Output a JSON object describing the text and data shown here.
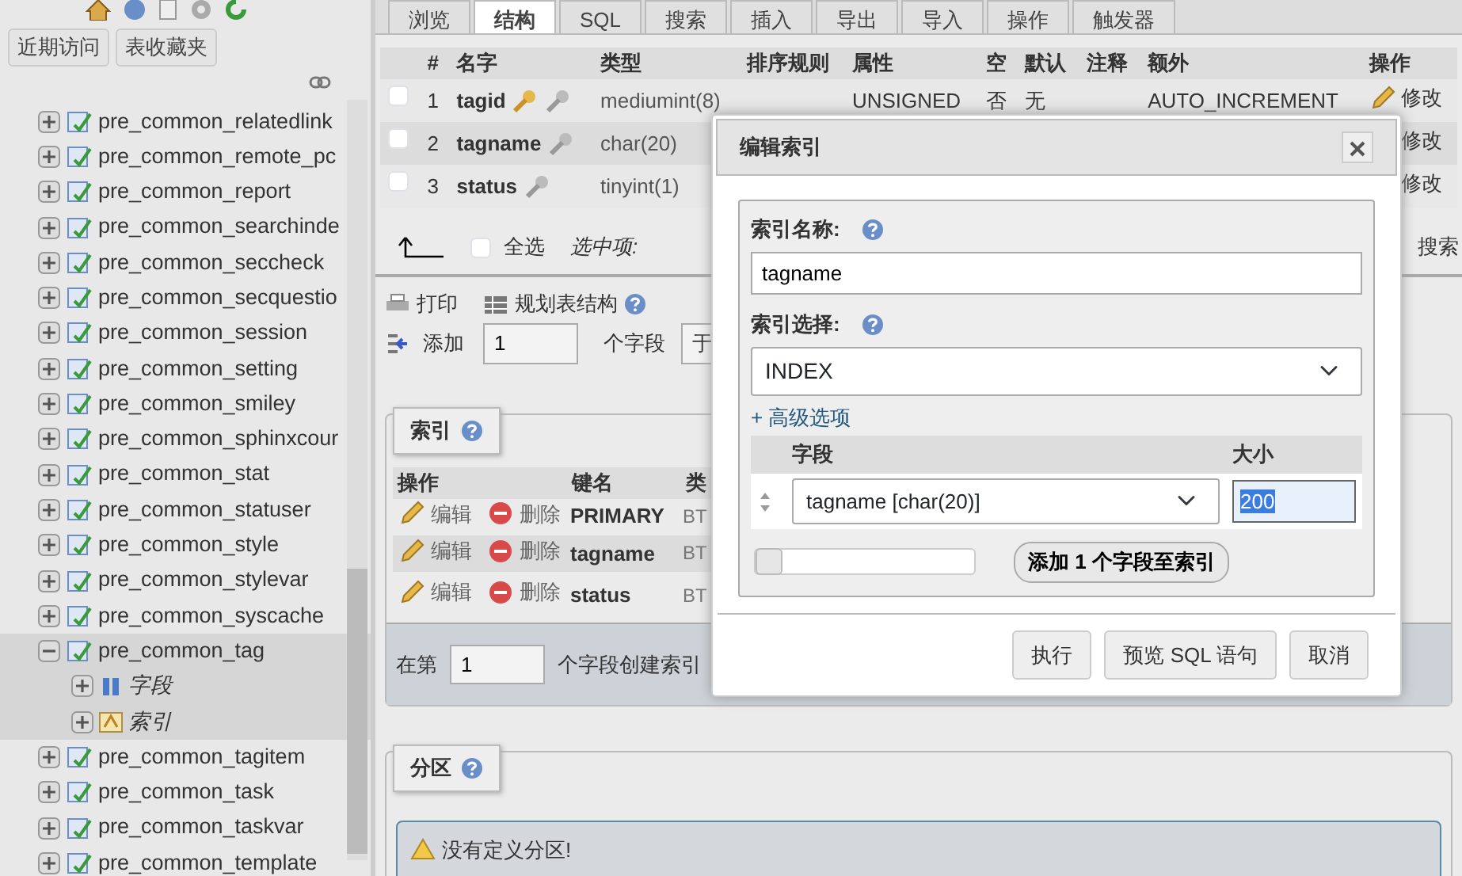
{
  "sidebar": {
    "buttons": [
      "近期访问",
      "表收藏夹"
    ],
    "tree": [
      {
        "label": "pre_common_relatedlink",
        "expanded": false
      },
      {
        "label": "pre_common_remote_pc",
        "expanded": false
      },
      {
        "label": "pre_common_report",
        "expanded": false
      },
      {
        "label": "pre_common_searchinde",
        "expanded": false
      },
      {
        "label": "pre_common_seccheck",
        "expanded": false
      },
      {
        "label": "pre_common_secquestio",
        "expanded": false
      },
      {
        "label": "pre_common_session",
        "expanded": false
      },
      {
        "label": "pre_common_setting",
        "expanded": false
      },
      {
        "label": "pre_common_smiley",
        "expanded": false
      },
      {
        "label": "pre_common_sphinxcour",
        "expanded": false
      },
      {
        "label": "pre_common_stat",
        "expanded": false
      },
      {
        "label": "pre_common_statuser",
        "expanded": false
      },
      {
        "label": "pre_common_style",
        "expanded": false
      },
      {
        "label": "pre_common_stylevar",
        "expanded": false
      },
      {
        "label": "pre_common_syscache",
        "expanded": false
      },
      {
        "label": "pre_common_tag",
        "expanded": true,
        "children": [
          {
            "label": "字段",
            "kind": "columns"
          },
          {
            "label": "索引",
            "kind": "indexes"
          }
        ]
      },
      {
        "label": "pre_common_tagitem",
        "expanded": false
      },
      {
        "label": "pre_common_task",
        "expanded": false
      },
      {
        "label": "pre_common_taskvar",
        "expanded": false
      },
      {
        "label": "pre_common_template",
        "expanded": false
      }
    ]
  },
  "tabs": [
    {
      "label": "浏览",
      "selected": false
    },
    {
      "label": "结构",
      "selected": true
    },
    {
      "label": "SQL",
      "selected": false
    },
    {
      "label": "搜索",
      "selected": false
    },
    {
      "label": "插入",
      "selected": false
    },
    {
      "label": "导出",
      "selected": false
    },
    {
      "label": "导入",
      "selected": false
    },
    {
      "label": "操作",
      "selected": false
    },
    {
      "label": "触发器",
      "selected": false
    }
  ],
  "structure": {
    "columns": [
      "#",
      "名字",
      "类型",
      "排序规则",
      "属性",
      "空",
      "默认",
      "注释",
      "额外",
      "操作"
    ],
    "rows": [
      {
        "checked": false,
        "highlighted": false,
        "number": "1",
        "name": "tagid",
        "primary": true,
        "type": "mediumint(8)",
        "attributes": "UNSIGNED",
        "null": "否",
        "default": "无",
        "extra": "AUTO_INCREMENT",
        "action": "修改"
      },
      {
        "checked": false,
        "highlighted": true,
        "number": "2",
        "name": "tagname",
        "primary": false,
        "type": "char(20)",
        "action": "修改"
      },
      {
        "checked": false,
        "highlighted": false,
        "number": "3",
        "name": "status",
        "primary": false,
        "type": "tinyint(1)",
        "action": "修改"
      }
    ],
    "check_all": {
      "label": "全选",
      "checked": false
    },
    "with_selected": "选中项:",
    "search_link": "搜索"
  },
  "actions": {
    "print": "打印",
    "plan": "规划表结构",
    "add_label": "添加",
    "add_count": "1",
    "add_unit": "个字段",
    "add_position": "于"
  },
  "indexes": {
    "legend": "索引",
    "columns": [
      "操作",
      "键名",
      "类"
    ],
    "rows": [
      {
        "edit": "编辑",
        "drop": "删除",
        "key_name": "PRIMARY",
        "type": "BT",
        "highlighted": false
      },
      {
        "edit": "编辑",
        "drop": "删除",
        "key_name": "tagname",
        "type": "BT",
        "highlighted": true
      },
      {
        "edit": "编辑",
        "drop": "删除",
        "key_name": "status",
        "type": "BT",
        "highlighted": false
      }
    ],
    "create_prefix": "在第",
    "create_count": "1",
    "create_suffix": "个字段创建索引"
  },
  "partitions": {
    "legend": "分区",
    "message": "没有定义分区!"
  },
  "dialog": {
    "title": "编辑索引",
    "name_label": "索引名称:",
    "name_value": "tagname",
    "choice_label": "索引选择:",
    "choice_value": "INDEX",
    "advanced": "+ 高级选项",
    "columns": [
      "字段",
      "大小"
    ],
    "fields": [
      {
        "column": "tagname [char(20)]",
        "size": "200"
      }
    ],
    "slider": {
      "level": 0
    },
    "add_button": "添加 1 个字段至索引",
    "buttons": [
      "执行",
      "预览 SQL 语句",
      "取消"
    ]
  }
}
